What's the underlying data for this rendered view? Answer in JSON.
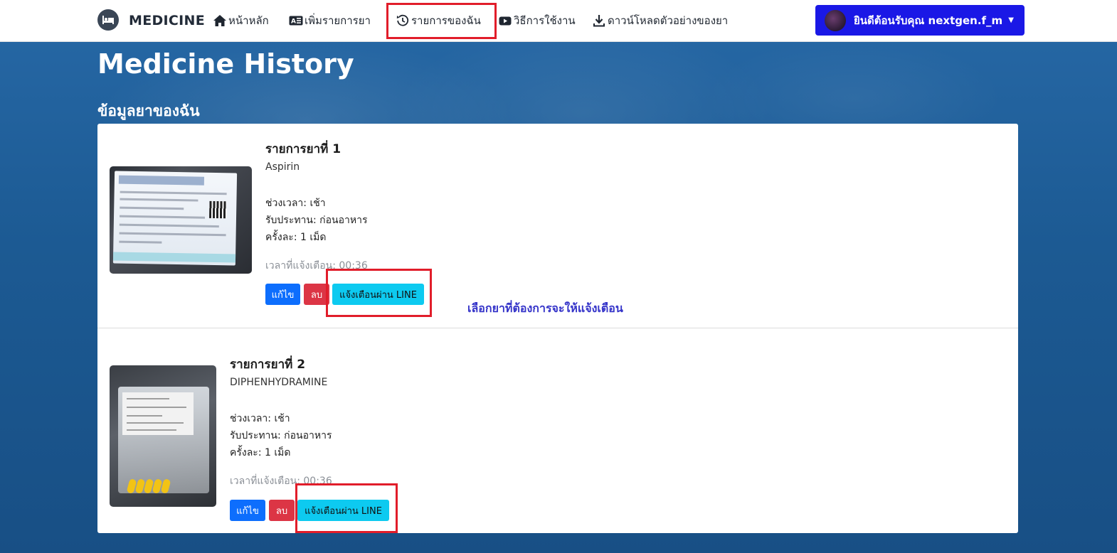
{
  "brand": {
    "name": "MEDICINE",
    "icon": "bed-icon"
  },
  "nav": {
    "home": "หน้าหลัก",
    "add": "เพิ่มรายการยา",
    "my_list": "รายการของฉัน",
    "how_to": "วิธีการใช้งาน",
    "download": "ดาวน์โหลดตัวอย่างของยา"
  },
  "user_menu": {
    "greeting": "ยินดีต้อนรับคุณ nextgen.f_m"
  },
  "page": {
    "title": "Medicine History",
    "section": "ข้อมูลยาของฉัน"
  },
  "items": [
    {
      "title": "รายการยาที่ 1",
      "name": "Aspirin",
      "period": "ช่วงเวลา: เช้า",
      "intake": "รับประทาน: ก่อนอาหาร",
      "dose": "ครั้งละ: 1 เม็ด",
      "notify_time": "เวลาที่แจ้งเตือน: 00:36",
      "edit_label": "แก้ไข",
      "delete_label": "ลบ",
      "line_label": "แจ้งเตือนผ่าน LINE"
    },
    {
      "title": "รายการยาที่ 2",
      "name": "DIPHENHYDRAMINE",
      "period": "ช่วงเวลา: เช้า",
      "intake": "รับประทาน: ก่อนอาหาร",
      "dose": "ครั้งละ: 1 เม็ด",
      "notify_time": "เวลาที่แจ้งเตือน: 00:36",
      "edit_label": "แก้ไข",
      "delete_label": "ลบ",
      "line_label": "แจ้งเตือนผ่าน LINE"
    }
  ],
  "annotation_hint": "เลือกยาที่ต้องการจะให้แจ้งเตือน",
  "colors": {
    "primary": "#0d6efd",
    "danger": "#dc3545",
    "info": "#0dcaf0",
    "user_button": "#1a18e6",
    "highlight": "#e11d2a",
    "hint_text": "#3534c9"
  }
}
